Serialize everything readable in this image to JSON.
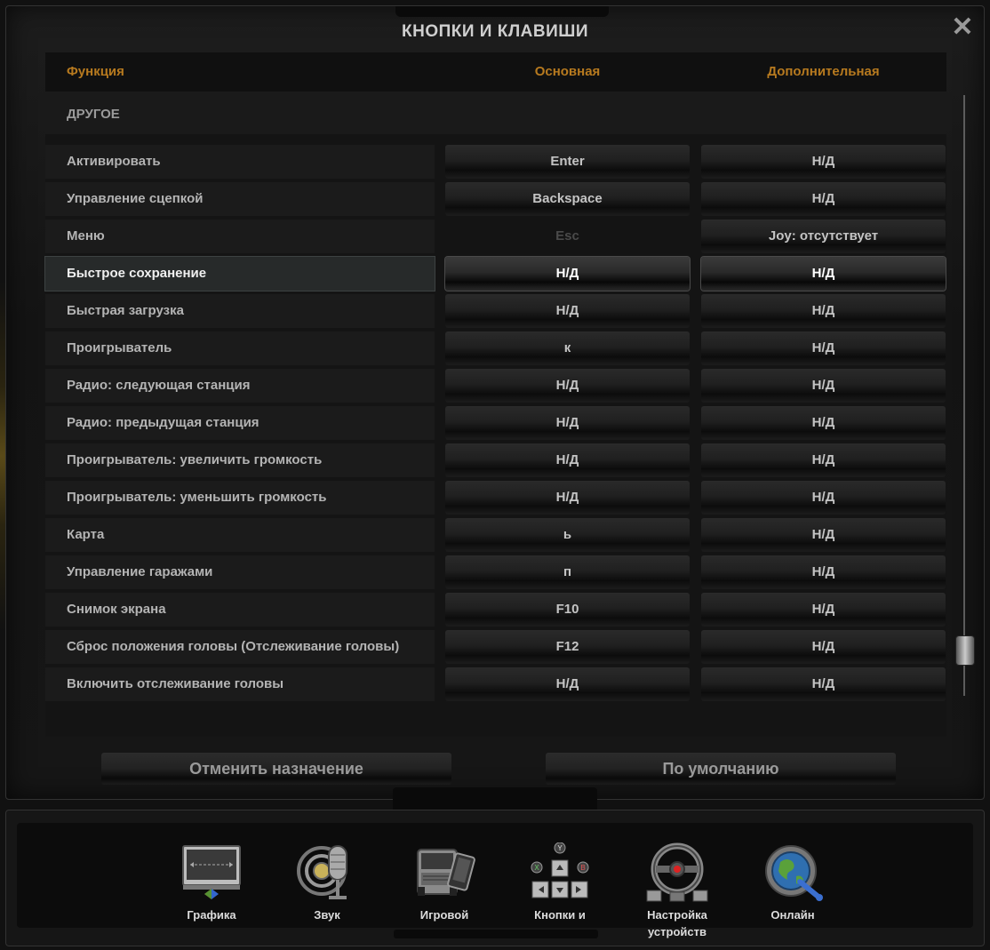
{
  "window": {
    "title": "КНОПКИ И КЛАВИШИ",
    "close_glyph": "✕"
  },
  "columns": {
    "function": "Функция",
    "primary": "Основная",
    "secondary": "Дополнительная"
  },
  "section": {
    "label": "ДРУГОЕ"
  },
  "rows": [
    {
      "function": "Активировать",
      "primary": "Enter",
      "secondary": "Н/Д"
    },
    {
      "function": "Управление сцепкой",
      "primary": "Backspace",
      "secondary": "Н/Д"
    },
    {
      "function": "Меню",
      "primary": "Esc",
      "secondary": "Joy: отсутствует",
      "primary_disabled": true
    },
    {
      "function": "Быстрое сохранение",
      "primary": "Н/Д",
      "secondary": "Н/Д",
      "selected": true
    },
    {
      "function": "Быстрая загрузка",
      "primary": "Н/Д",
      "secondary": "Н/Д"
    },
    {
      "function": "Проигрыватель",
      "primary": "к",
      "secondary": "Н/Д"
    },
    {
      "function": "Радио: следующая станция",
      "primary": "Н/Д",
      "secondary": "Н/Д"
    },
    {
      "function": "Радио: предыдущая станция",
      "primary": "Н/Д",
      "secondary": "Н/Д"
    },
    {
      "function": "Проигрыватель: увеличить громкость",
      "primary": "Н/Д",
      "secondary": "Н/Д"
    },
    {
      "function": "Проигрыватель: уменьшить громкость",
      "primary": "Н/Д",
      "secondary": "Н/Д"
    },
    {
      "function": "Карта",
      "primary": "ь",
      "secondary": "Н/Д"
    },
    {
      "function": "Управление гаражами",
      "primary": "п",
      "secondary": "Н/Д"
    },
    {
      "function": "Снимок экрана",
      "primary": "F10",
      "secondary": "Н/Д"
    },
    {
      "function": "Сброс положения головы (Отслеживание головы)",
      "primary": "F12",
      "secondary": "Н/Д"
    },
    {
      "function": "Включить отслеживание головы",
      "primary": "Н/Д",
      "secondary": "Н/Д"
    }
  ],
  "actions": {
    "unassign": "Отменить назначение",
    "default": "По умолчанию"
  },
  "nav": [
    {
      "id": "graphics",
      "label": "Графика",
      "icon": "monitor-icon"
    },
    {
      "id": "sound",
      "label": "Звук",
      "icon": "microphone-icon"
    },
    {
      "id": "gameplay",
      "label": "Игровой\nпроцесс",
      "icon": "truck-icon"
    },
    {
      "id": "controls",
      "label": "Кнопки и\nклавиши",
      "icon": "keys-icon"
    },
    {
      "id": "devices",
      "label": "Настройка\nустройств",
      "icon": "steering-wheel-icon"
    },
    {
      "id": "online",
      "label": "Онлайн",
      "icon": "globe-icon"
    }
  ],
  "colors": {
    "header_accent": "#b77a1f",
    "background": "#141414"
  }
}
